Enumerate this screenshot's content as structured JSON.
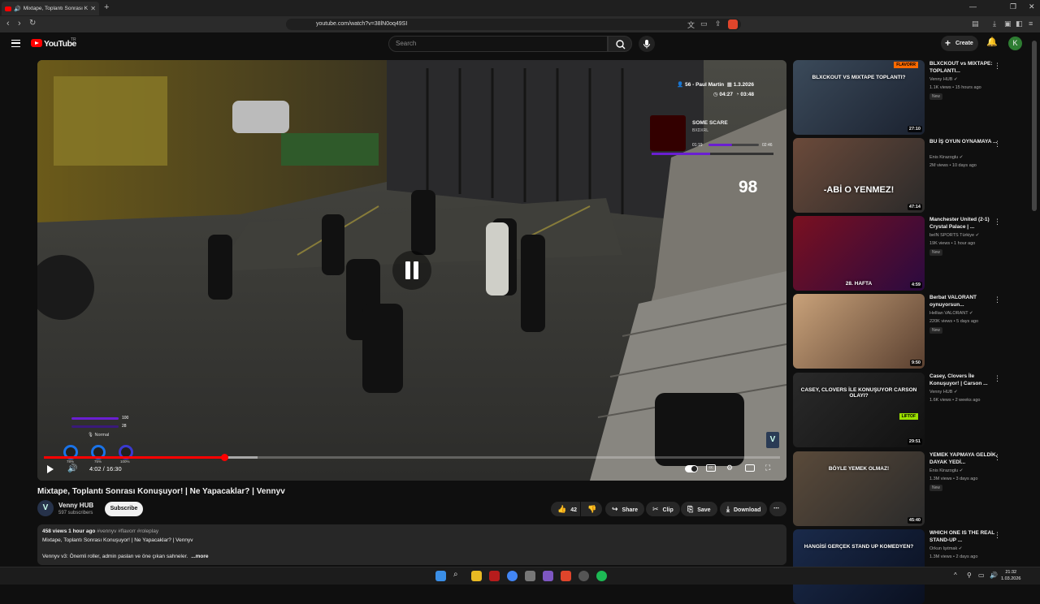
{
  "browser": {
    "tab_title": "Mixtape, Toplantı Sonrası Ko",
    "url": "youtube.com/watch?v=38lN0oq49SI"
  },
  "header": {
    "logo_text": "YouTube",
    "logo_sup": "TR",
    "search_placeholder": "Search",
    "create_label": "Create",
    "avatar_letter": "K"
  },
  "player": {
    "hud_player": "56 - Paul Martin",
    "hud_date": "1.3.2026",
    "hud_time1": "04:27",
    "hud_time2": "03:48",
    "now_playing": {
      "song": "SOME SCARE",
      "artist": "BXDXRL",
      "elapsed": "01:19",
      "total": "02:46",
      "progress": 0.47
    },
    "counter": "98",
    "health": "100",
    "armor": "28",
    "voice_mode": "Normal",
    "ring_labels": [
      "78%",
      "75%",
      "100%"
    ],
    "current_time": "4:02 / 16:30",
    "progress": 0.245,
    "buffered": 0.29
  },
  "video": {
    "title": "Mixtape, Toplantı Sonrası Konuşuyor! | Ne Yapacaklar? | Vennyv",
    "channel": "Venny HUB",
    "subscribers": "597 subscribers",
    "subscribe_label": "Subscribe",
    "likes": "42",
    "share_label": "Share",
    "clip_label": "Clip",
    "save_label": "Save",
    "download_label": "Download",
    "description": {
      "meta": "458 views  1 hour ago",
      "tags": "#vennyv #flavorr #roleplay",
      "line1": "Mixtape, Toplantı Sonrası Konuşuyor! | Ne Yapacaklar? | Vennyv",
      "line2": "Vennyv v3: Önemli roller, admin paslan ve öne çıkan sahneler.",
      "more_label": "...more"
    }
  },
  "recommendations": [
    {
      "title": "BLXCKOUT vs MIXTAPE: TOPLANTI...",
      "channel": "Venny HUB",
      "views": "1.1K views • 15 hours ago",
      "badge": "New",
      "duration": "27:10",
      "thumb_text": "BLXCKOUT VS MIXTAPE TOPLANTI?",
      "thumb_tag": "FLAVORR"
    },
    {
      "title": "BU İŞ OYUN OYNAMAYA ...",
      "channel": "Enis Kirazoglu",
      "views": "2M views • 10 days ago",
      "badge": "",
      "duration": "47:14",
      "thumb_text": "-ABİ O YENMEZ!",
      "thumb_tag": ""
    },
    {
      "title": "Manchester United (2-1) Crystal Palace | ...",
      "channel": "beIN SPORTS Türkiye",
      "views": "19K views • 1 hour ago",
      "badge": "New",
      "duration": "4:59",
      "thumb_text": "28. HAFTA",
      "thumb_tag": ""
    },
    {
      "title": "Berbat VALORANT oynuyorsun...",
      "channel": "Hellian VALORANT",
      "views": "220K views • 5 days ago",
      "badge": "New",
      "duration": "9:50",
      "thumb_text": "",
      "thumb_tag": ""
    },
    {
      "title": "Casey, Clovers İle Konuşuyor! | Carson ...",
      "channel": "Venny HUB",
      "views": "1.6K views • 2 weeks ago",
      "badge": "",
      "duration": "29:51",
      "thumb_text": "CASEY, CLOVERS İLE KONUŞUYOR CARSON OLAYI?",
      "thumb_tag": "LIFTOF"
    },
    {
      "title": "YEMEK YAPMAYA GELDİK, DAYAK YEDİ...",
      "channel": "Enis Kirazoglu",
      "views": "1.3M views • 3 days ago",
      "badge": "New",
      "duration": "45:40",
      "thumb_text": "BÖYLE YEMEK OLMAZ!",
      "thumb_tag": ""
    },
    {
      "title": "WHICH ONE IS THE REAL STAND-UP ...",
      "channel": "Orkun Işıtmak",
      "views": "1.3M views • 2 days ago",
      "badge": "",
      "duration": "",
      "thumb_text": "HANGİSİ GERÇEK STAND UP KOMEDYEN?",
      "thumb_tag": ""
    }
  ],
  "taskbar": {
    "time": "21:32",
    "date": "1.03.2026"
  }
}
